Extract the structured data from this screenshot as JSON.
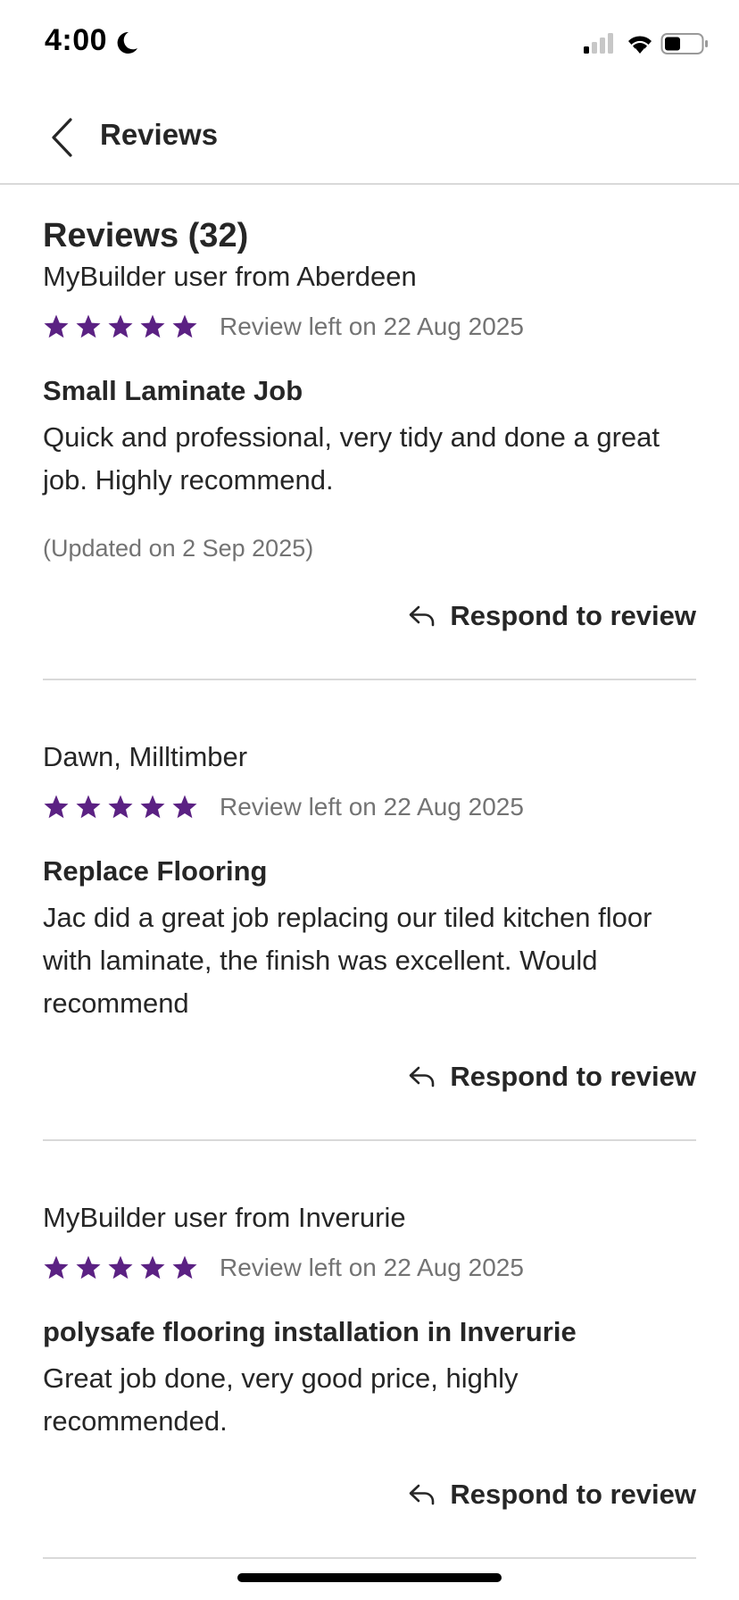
{
  "status": {
    "time": "4:00",
    "focus_icon": "moon-icon",
    "signal_icon": "signal-icon",
    "wifi_icon": "wifi-icon",
    "battery_icon": "battery-icon"
  },
  "nav": {
    "back_icon": "chevron-left-icon",
    "title": "Reviews"
  },
  "section": {
    "title": "Reviews (32)"
  },
  "colors": {
    "star": "#5b2183",
    "muted_text": "#737373",
    "text": "#262626",
    "divider": "#d9d9d9"
  },
  "reviews": [
    {
      "reviewer": "MyBuilder user from Aberdeen",
      "rating": 5,
      "date": "Review left on 22 Aug 2025",
      "title": "Small Laminate Job",
      "body": "Quick and professional, very tidy and done a great job. Highly recommend.",
      "updated": "(Updated on 2 Sep 2025)",
      "respond_label": "Respond to review"
    },
    {
      "reviewer": "Dawn, Milltimber",
      "rating": 5,
      "date": "Review left on 22 Aug 2025",
      "title": "Replace Flooring",
      "body": "Jac did a great job replacing our tiled kitchen floor with laminate, the finish was excellent. Would recommend",
      "respond_label": "Respond to review"
    },
    {
      "reviewer": "MyBuilder user from Inverurie",
      "rating": 5,
      "date": "Review left on 22 Aug 2025",
      "title": "polysafe flooring installation in Inverurie",
      "body": "Great job done, very good price, highly recommended.",
      "respond_label": "Respond to review"
    }
  ]
}
